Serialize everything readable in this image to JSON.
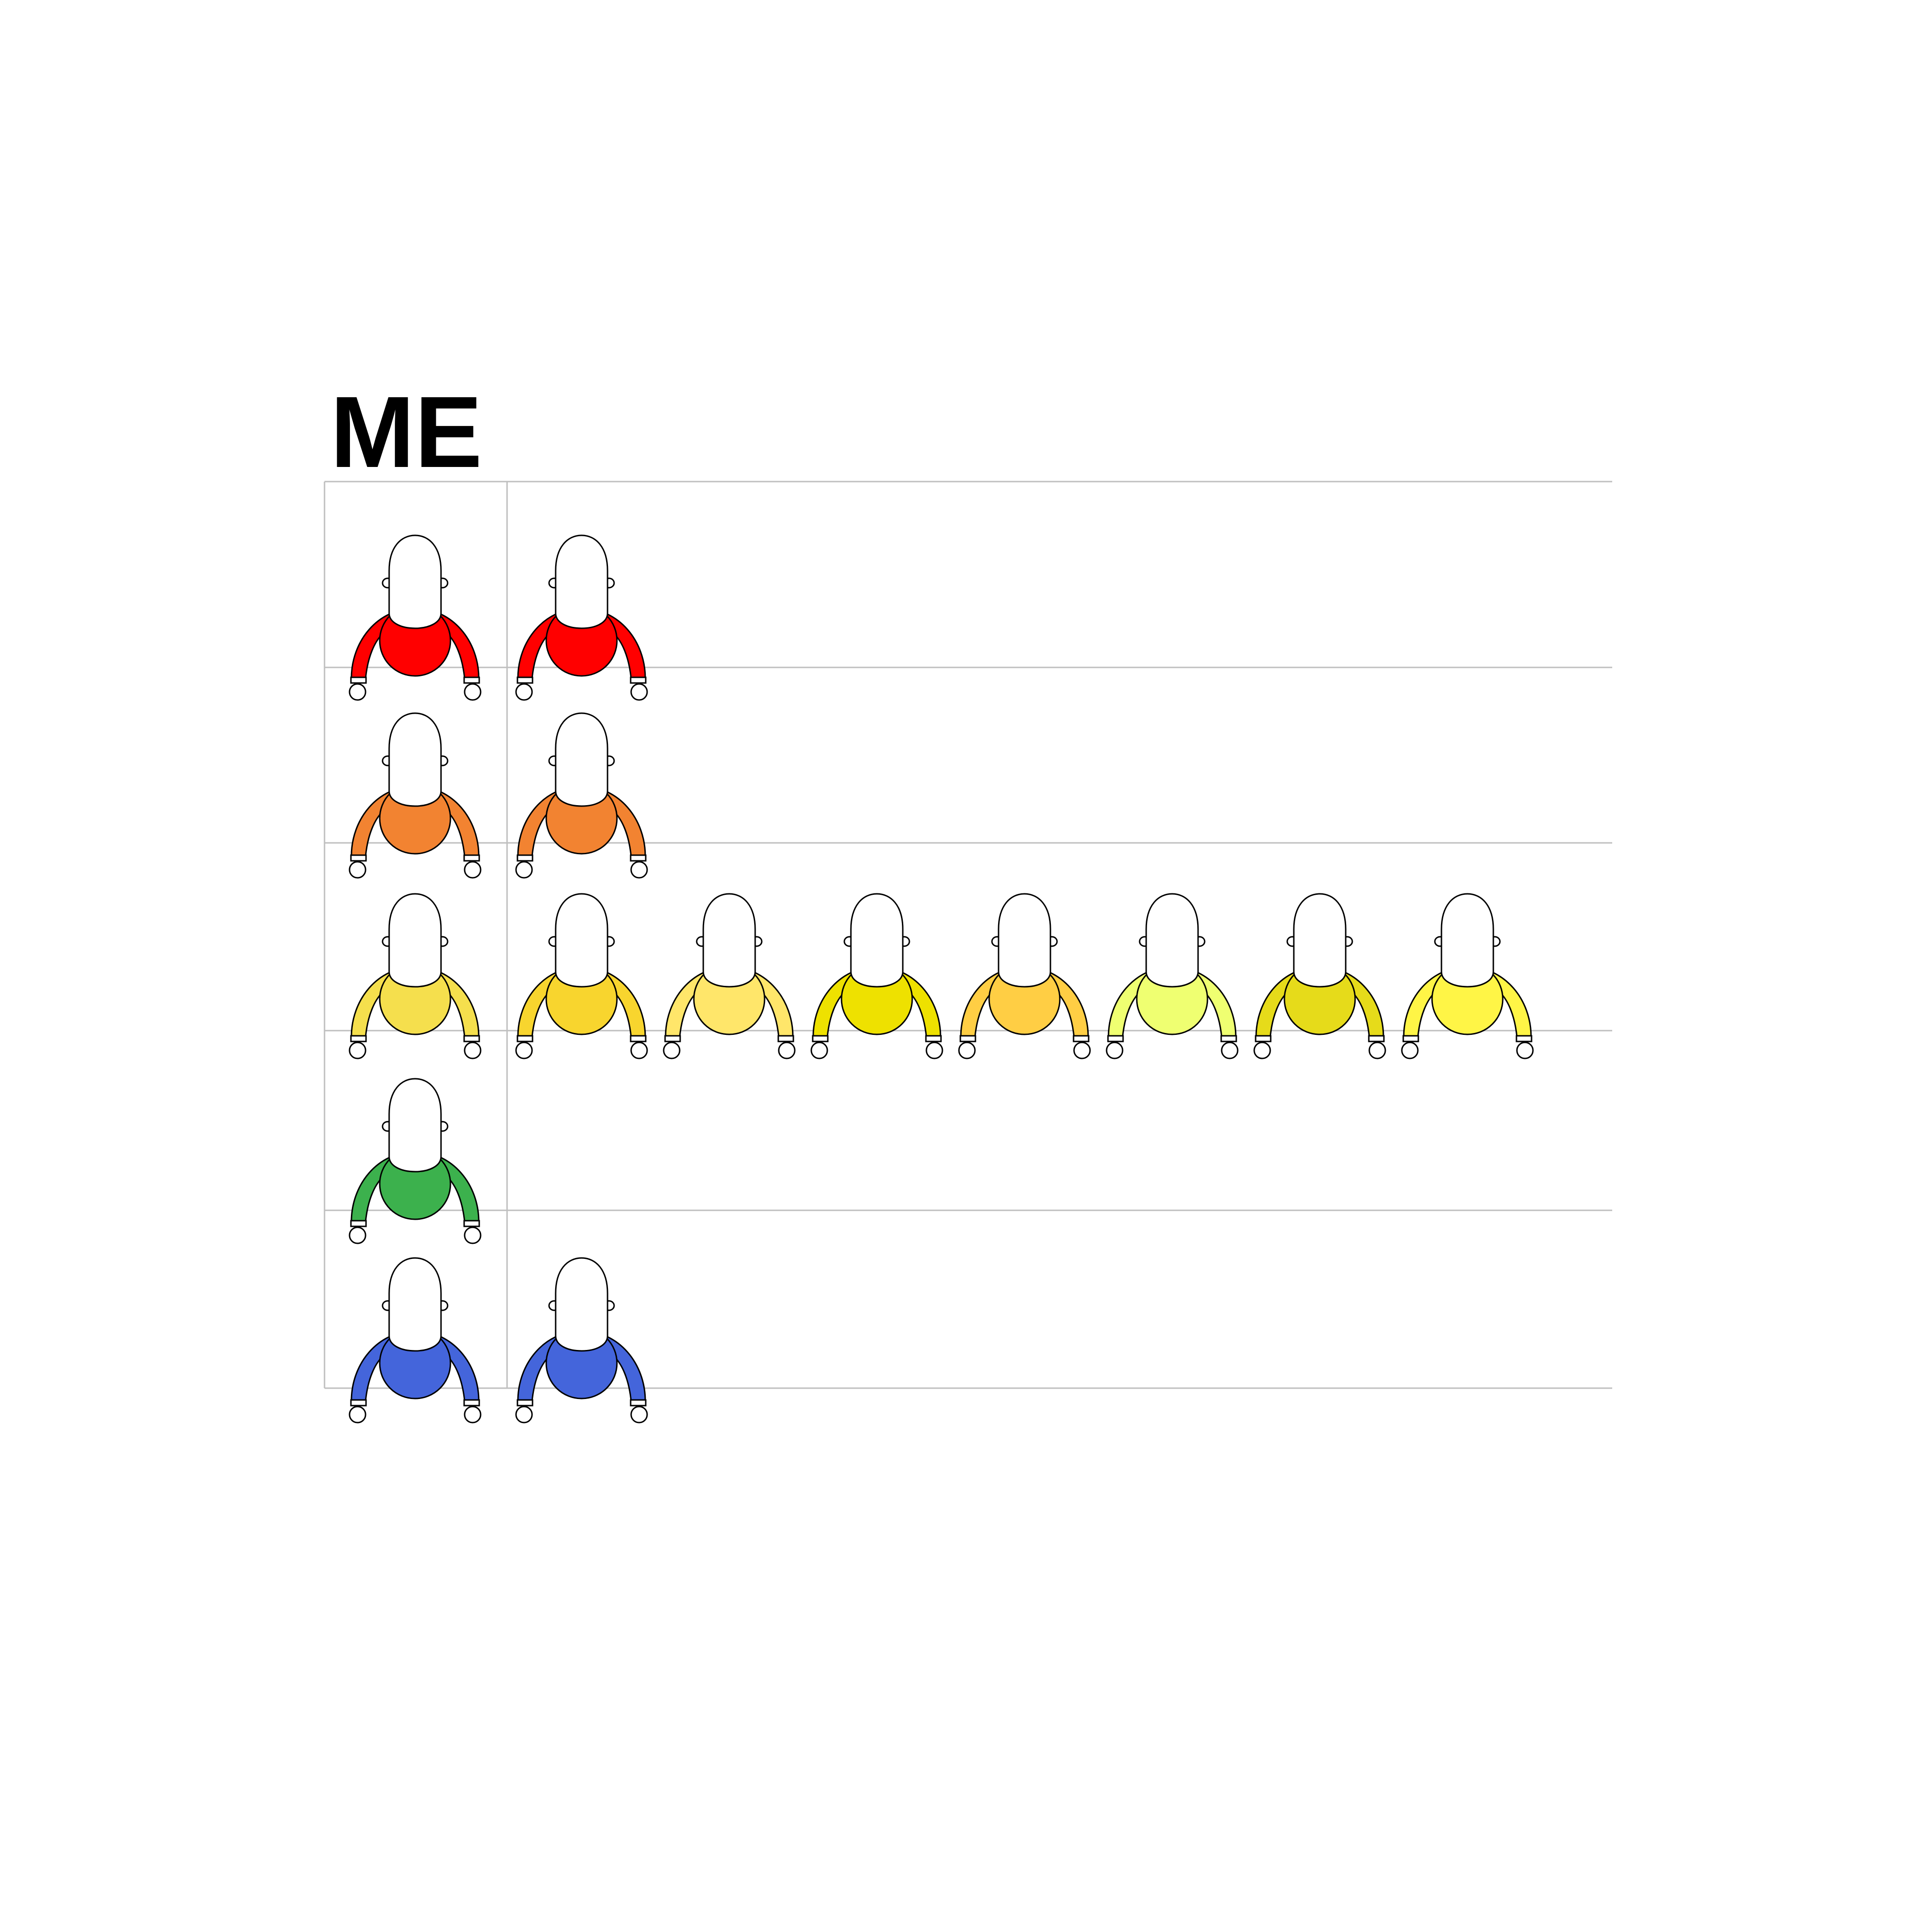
{
  "title": "ME",
  "rows": [
    {
      "name": "red",
      "me_color": "#FF0000",
      "others": [
        "#FF0000"
      ]
    },
    {
      "name": "orange",
      "me_color": "#F28331",
      "others": [
        "#F28331"
      ]
    },
    {
      "name": "yellow",
      "me_color": "#F5DF4D",
      "others": [
        "#F8D52E",
        "#FFE66A",
        "#EEE100",
        "#FFCE44",
        "#EFFF71",
        "#E6DB1A",
        "#FFF546"
      ]
    },
    {
      "name": "green",
      "me_color": "#3CB14D",
      "others": []
    },
    {
      "name": "blue",
      "me_color": "#4465DB",
      "others": [
        "#4465DB"
      ]
    }
  ],
  "colors": {
    "grid_line": "#BFBFBF",
    "outline": "#000000",
    "skin": "#FFFFFF",
    "title": "#000000"
  }
}
